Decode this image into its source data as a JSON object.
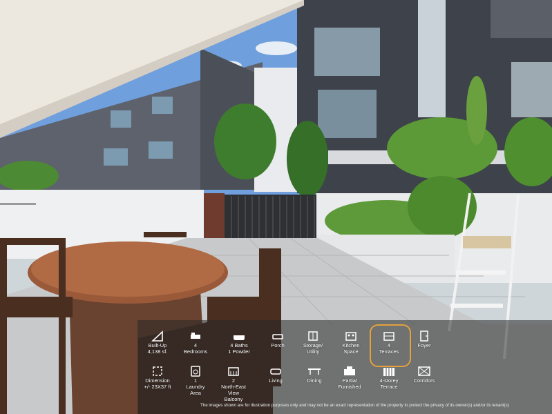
{
  "listing_features": {
    "row1": [
      {
        "id": "built-up",
        "label": "Built-Up\n4,138 sf.",
        "icon": "triangle-ruler-icon"
      },
      {
        "id": "bedrooms",
        "label": "4\nBedrooms",
        "icon": "bed-icon"
      },
      {
        "id": "baths",
        "label": "4 Baths\n1 Powder",
        "icon": "bathtub-icon"
      },
      {
        "id": "porch",
        "label": "Porch",
        "icon": "sofa-icon"
      },
      {
        "id": "storage",
        "label": "Storage/\nUtility",
        "icon": "storage-icon"
      },
      {
        "id": "kitchen",
        "label": "Kitchen\nSpace",
        "icon": "stove-icon"
      },
      {
        "id": "terraces",
        "label": "4\nTerraces",
        "icon": "terrace-icon",
        "active": true
      },
      {
        "id": "foyer",
        "label": "Foyer",
        "icon": "door-icon"
      }
    ],
    "row2": [
      {
        "id": "dimension",
        "label": "Dimension\n+/- 23X37 ft",
        "icon": "dimension-icon"
      },
      {
        "id": "laundry",
        "label": "1\nLaundry\nArea",
        "icon": "washer-icon"
      },
      {
        "id": "view",
        "label": "2\nNorth-East\nView\nBalcony",
        "icon": "balcony-icon"
      },
      {
        "id": "living",
        "label": "Living",
        "icon": "couch-icon"
      },
      {
        "id": "dining",
        "label": "Dining",
        "icon": "dining-table-icon"
      },
      {
        "id": "furnished",
        "label": "Partial\nFurnished",
        "icon": "furniture-icon"
      },
      {
        "id": "storey",
        "label": "4-storey\nTerrace",
        "icon": "building-icon"
      },
      {
        "id": "corridors",
        "label": "Corridors",
        "icon": "corridor-icon"
      }
    ]
  },
  "disclaimer": "The images shown are for illustration purposes only and may not be an exact representation of the property to protect the privacy of its owner(s) and/or its tenant(s)",
  "colors": {
    "highlight": "#e3a23c",
    "panel": "rgba(40,40,40,0.55)"
  }
}
